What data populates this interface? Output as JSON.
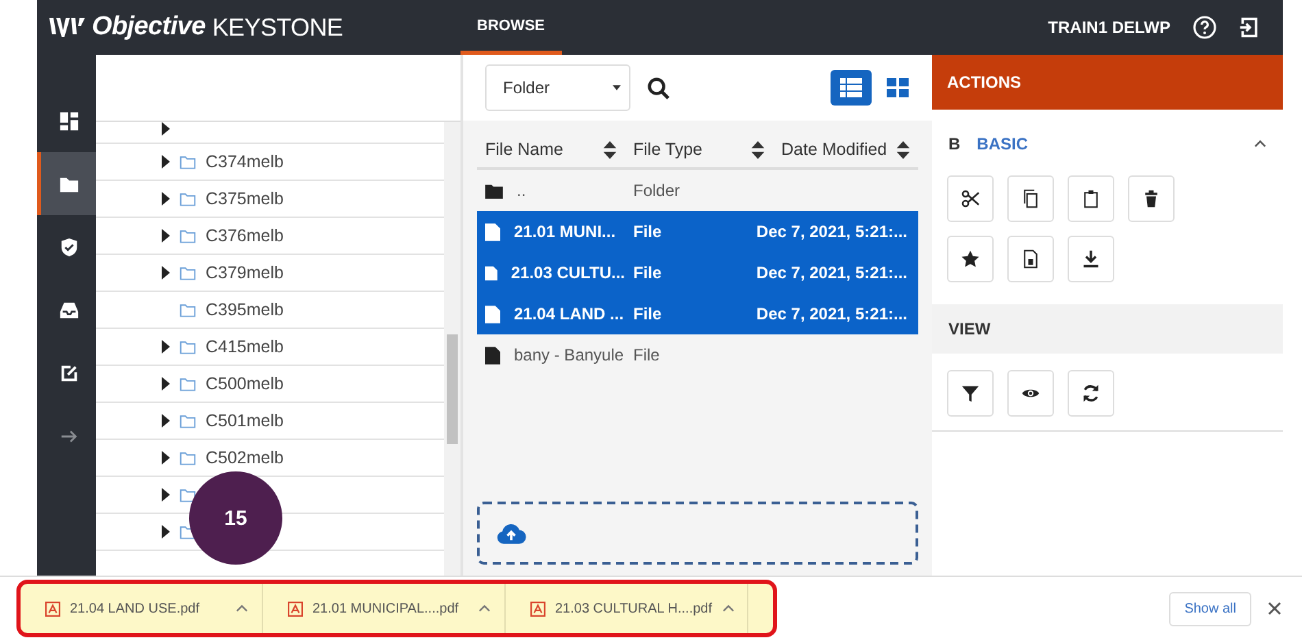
{
  "header": {
    "logo_bold": "Objective",
    "logo_light": "KEYSTONE",
    "tabs": [
      {
        "label": "BROWSE",
        "selected": true
      }
    ],
    "user": "TRAIN1 DELWP"
  },
  "rail": [
    {
      "selected": false
    },
    {
      "selected": true
    },
    {
      "selected": false
    },
    {
      "selected": false
    },
    {
      "selected": false
    },
    {
      "selected": false
    }
  ],
  "tree": [
    {
      "label": "C374melb",
      "has_children": true
    },
    {
      "label": "C375melb",
      "has_children": true
    },
    {
      "label": "C376melb",
      "has_children": true
    },
    {
      "label": "C379melb",
      "has_children": true
    },
    {
      "label": "C395melb",
      "has_children": false
    },
    {
      "label": "C415melb",
      "has_children": true
    },
    {
      "label": "C500melb",
      "has_children": true
    },
    {
      "label": "C501melb",
      "has_children": true
    },
    {
      "label": "C502melb",
      "has_children": true
    },
    {
      "has_children": true
    },
    {
      "has_children": true
    }
  ],
  "browser": {
    "scope": "Folder",
    "view_modes": [
      {
        "kind": "list",
        "selected": true
      },
      {
        "kind": "grid",
        "selected": false
      }
    ],
    "columns": [
      "File Name",
      "File Type",
      "Date Modified"
    ],
    "rows": [
      {
        "kind": "folder",
        "name": "..",
        "type": "Folder",
        "selected": false
      },
      {
        "kind": "file",
        "name": "21.01 MUNI...",
        "type": "File",
        "date": "Dec 7, 2021, 5:21:...",
        "selected": true
      },
      {
        "kind": "file",
        "name": "21.03 CULTU...",
        "type": "File",
        "date": "Dec 7, 2021, 5:21:...",
        "selected": true
      },
      {
        "kind": "file",
        "name": "21.04 LAND ...",
        "type": "File",
        "date": "Dec 7, 2021, 5:21:...",
        "selected": true
      },
      {
        "kind": "file",
        "name": "bany - Banyule",
        "type": "File",
        "selected": false
      }
    ]
  },
  "actions": {
    "title": "ACTIONS",
    "sections": [
      {
        "key": "B",
        "title": "BASIC",
        "expanded": true
      },
      {
        "title": "VIEW"
      }
    ]
  },
  "annotation_badge": "15",
  "downloads": {
    "items": [
      "21.04 LAND USE.pdf",
      "21.01 MUNICIPAL....pdf",
      "21.03 CULTURAL H....pdf"
    ],
    "show_all": "Show all"
  }
}
